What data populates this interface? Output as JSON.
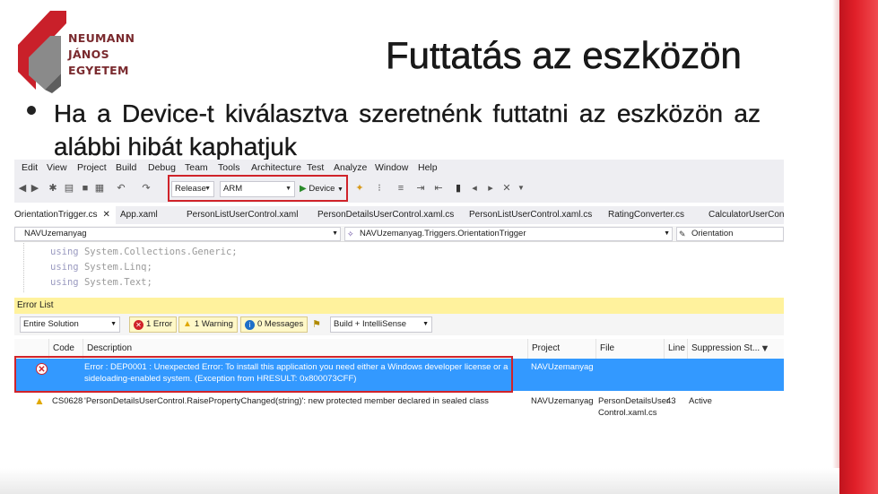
{
  "logo": {
    "line1": "NEUMANN",
    "line2": "JÁNOS",
    "line3": "EGYETEM"
  },
  "slide": {
    "title": "Futtatás az eszközön",
    "bullet": "Ha a Device-t kiválasztva szeretnénk futtatni az eszközön az alábbi hibát kaphatjuk"
  },
  "colors": {
    "brand_red": "#e01f28",
    "selection_blue": "#3399ff",
    "error_list_header": "#fff29d",
    "highlight_box": "#d0232a"
  },
  "vs": {
    "menu": [
      "Edit",
      "View",
      "Project",
      "Build",
      "Debug",
      "Team",
      "Tools",
      "Architecture",
      "Test",
      "Analyze",
      "Window",
      "Help"
    ],
    "toolbar": {
      "config": "Release",
      "platform": "ARM",
      "run_target": "Device"
    },
    "tabs": [
      "OrientationTrigger.cs",
      "App.xaml",
      "PersonListUserControl.xaml",
      "PersonDetailsUserControl.xaml.cs",
      "PersonListUserControl.xaml.cs",
      "RatingConverter.cs",
      "CalculatorUserContro"
    ],
    "nav": {
      "project": "NAVUzemanyag",
      "type": "NAVUzemanyag.Triggers.OrientationTrigger",
      "member": "Orientation"
    },
    "code_lines": [
      {
        "kw": "using",
        "ns": "System.Collections.Generic;"
      },
      {
        "kw": "using",
        "ns": "System.Linq;"
      },
      {
        "kw": "using",
        "ns": "System.Text;"
      }
    ],
    "error_list": {
      "title": "Error List",
      "scope": "Entire Solution",
      "errors": "1 Error",
      "warnings": "1 Warning",
      "messages": "0 Messages",
      "build_filter": "Build + IntelliSense",
      "columns": [
        "Code",
        "Description",
        "Project",
        "File",
        "Line",
        "Suppression St..."
      ],
      "rows": [
        {
          "code": "",
          "description_1": "Error : DEP0001 : Unexpected Error: To install this application you need either a Windows developer license or a",
          "description_2": "sideloading-enabled system. (Exception from HRESULT: 0x800073CFF)",
          "project": "NAVUzemanyag",
          "file_1": "",
          "file_2": "",
          "line": "",
          "suppression": ""
        },
        {
          "code": "CS0628",
          "description_1": "'PersonDetailsUserControl.RaisePropertyChanged(string)': new protected member declared in sealed class",
          "description_2": "",
          "project": "NAVUzemanyag",
          "file_1": "PersonDetailsUser",
          "file_2": "Control.xaml.cs",
          "line": "43",
          "suppression": "Active"
        }
      ]
    }
  }
}
